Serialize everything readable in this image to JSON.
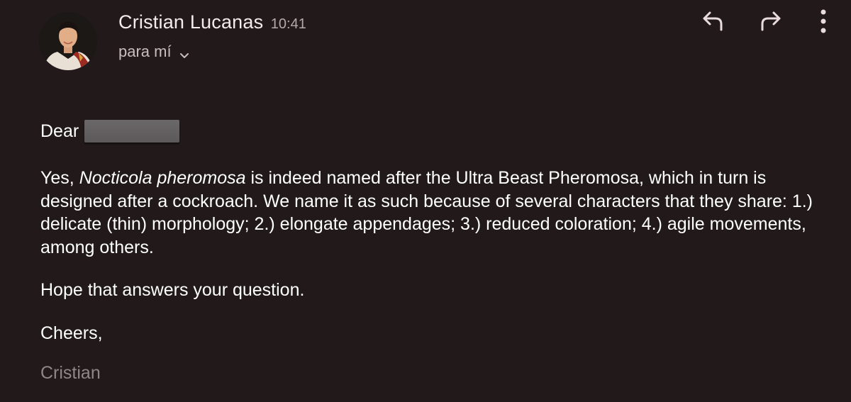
{
  "sender": {
    "name": "Cristian Lucanas",
    "time": "10:41"
  },
  "recipient": {
    "label": "para mí"
  },
  "icons": {
    "reply": "reply-icon",
    "forward": "forward-icon",
    "more": "more-vert-icon",
    "expand": "chevron-down-icon"
  },
  "colors": {
    "background": "#221a1a",
    "text": "#ffffff",
    "muted": "#c9bdbd",
    "signature": "#8f8686"
  },
  "message": {
    "greeting": "Dear",
    "paragraph1": {
      "pre": "Yes, ",
      "species": "Nocticola pheromosa",
      "post": " is indeed named after the Ultra Beast Pheromosa, which in turn is designed after a cockroach. We name it as such because of several characters that they share: 1.) delicate (thin) morphology; 2.) elongate appendages; 3.) reduced coloration; 4.) agile movements, among others."
    },
    "paragraph2": "Hope that answers your question.",
    "closing": "Cheers,",
    "signature": "Cristian"
  }
}
